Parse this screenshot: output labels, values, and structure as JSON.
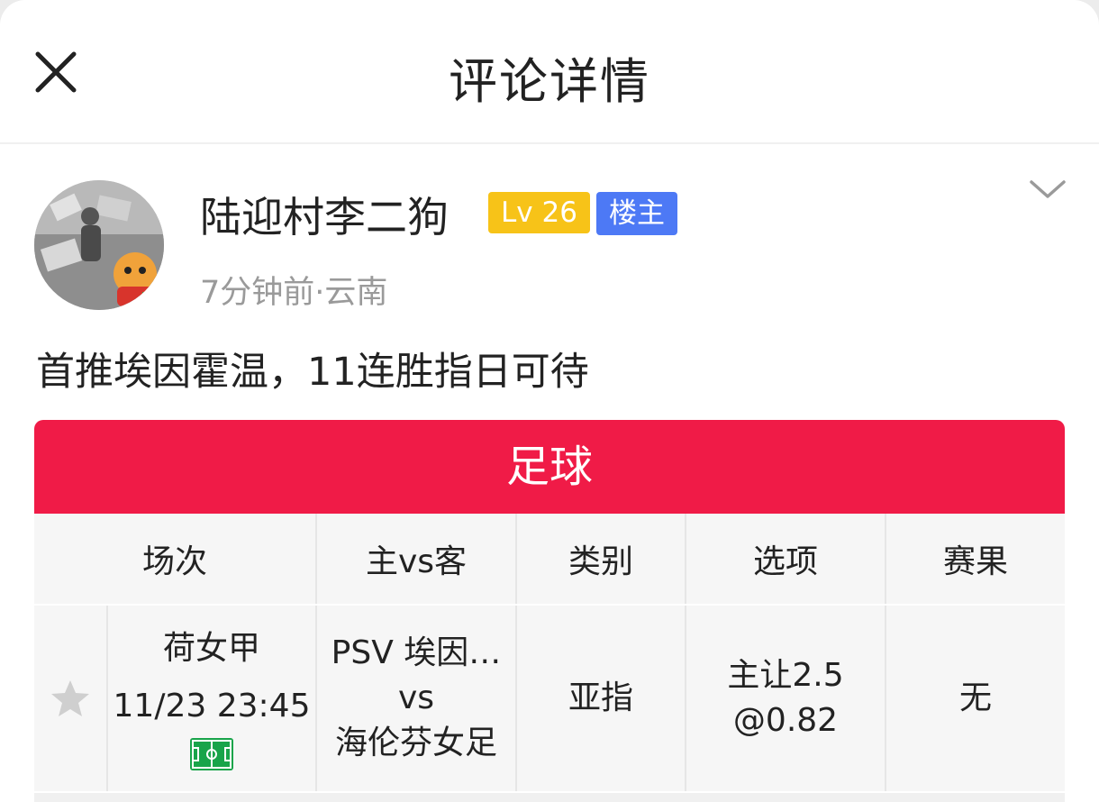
{
  "header": {
    "title": "评论详情"
  },
  "post": {
    "username": "陆迎村李二狗",
    "level_badge": "Lv 26",
    "owner_badge": "楼主",
    "meta": "7分钟前·云南",
    "comment": "首推埃因霍温，11连胜指日可待"
  },
  "card": {
    "category": "足球",
    "columns": [
      "场次",
      "主vs客",
      "类别",
      "选项",
      "赛果"
    ],
    "row": {
      "league": "荷女甲",
      "time": "11/23 23:45",
      "home": "PSV 埃因…",
      "vs": "vs",
      "away": "海伦芬女足",
      "type": "亚指",
      "option_line1": "主让2.5",
      "option_line2": "@0.82",
      "result": "无"
    }
  },
  "colors": {
    "accent_red": "#f01b47",
    "level_yellow": "#f7c318",
    "owner_blue": "#4d79f5",
    "field_green": "#19a44a"
  },
  "icons": [
    "close-icon",
    "chevron-down-icon",
    "star-icon",
    "football-field-icon"
  ]
}
